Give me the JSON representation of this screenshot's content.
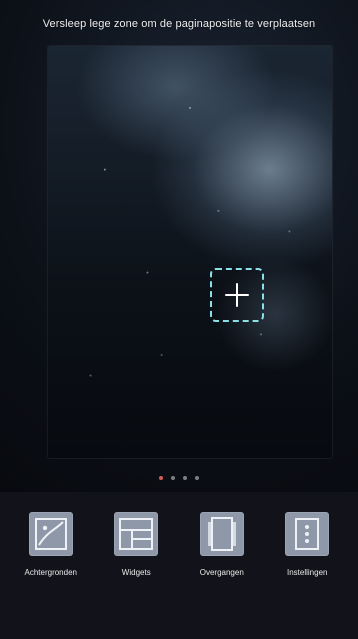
{
  "overlay": {
    "hint_text": "Versleep lege zone om de paginapositie te verplaatsen"
  },
  "page_indicator": {
    "active_index": 0,
    "count": 4
  },
  "dock": {
    "items": [
      {
        "label": "Achtergronden",
        "icon": "wallpaper-icon"
      },
      {
        "label": "Widgets",
        "icon": "widgets-icon"
      },
      {
        "label": "Overgangen",
        "icon": "transitions-icon"
      },
      {
        "label": "Instellingen",
        "icon": "settings-icon"
      }
    ]
  },
  "colors": {
    "dashed_border": "#8be0e6",
    "active_dot": "#d55b56",
    "tile": "#8e98a8"
  }
}
